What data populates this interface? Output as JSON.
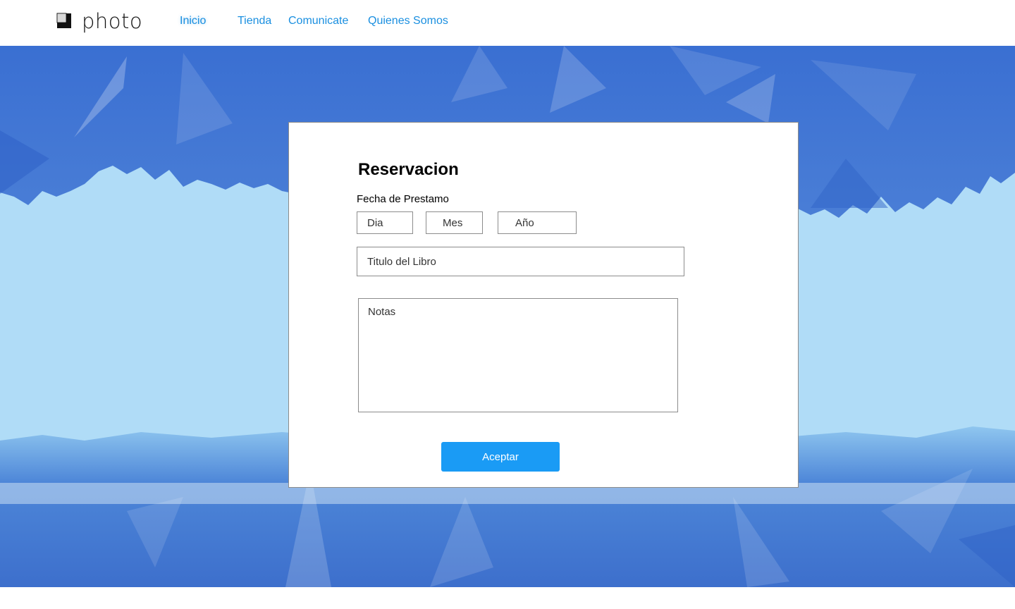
{
  "brand": {
    "name": "photo",
    "logo_icon": "square-stack-icon"
  },
  "nav": {
    "items": [
      {
        "label": "Inicio",
        "active": true
      },
      {
        "label": "Tienda",
        "active": false
      },
      {
        "label": "Comunicate",
        "active": false
      },
      {
        "label": "Quienes Somos",
        "active": false
      }
    ]
  },
  "form": {
    "title": "Reservacion",
    "date_label": "Fecha de Prestamo",
    "day_placeholder": "Dia",
    "month_placeholder": "Mes",
    "year_placeholder": "Año",
    "book_title_placeholder": "Titulo del Libro",
    "notes_placeholder": "Notas",
    "submit_label": "Aceptar"
  },
  "colors": {
    "accent": "#1a9bf5",
    "nav_link": "#1a8fe0",
    "sky_light": "#afdcf7",
    "sky_dark": "#3b6fd0"
  }
}
